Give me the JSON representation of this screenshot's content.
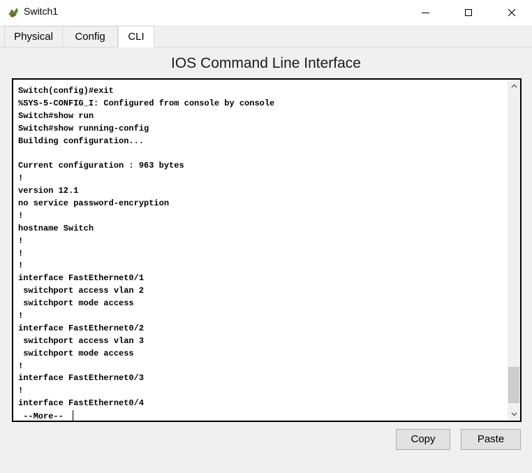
{
  "window": {
    "title": "Switch1",
    "icon": "switch-device-icon",
    "controls": {
      "minimize_icon": "minimize-icon",
      "maximize_icon": "maximize-icon",
      "close_icon": "close-icon",
      "close_glyph": "✕"
    }
  },
  "tabs": [
    {
      "label": "Physical",
      "active": false
    },
    {
      "label": "Config",
      "active": false
    },
    {
      "label": "CLI",
      "active": true
    }
  ],
  "cli": {
    "heading": "IOS Command Line Interface",
    "lines": [
      "Switch(config)#exit",
      "%SYS-5-CONFIG_I: Configured from console by console",
      "Switch#show run",
      "Switch#show running-config",
      "Building configuration...",
      "",
      "Current configuration : 963 bytes",
      "!",
      "version 12.1",
      "no service password-encryption",
      "!",
      "hostname Switch",
      "!",
      "!",
      "!",
      "interface FastEthernet0/1",
      " switchport access vlan 2",
      " switchport mode access",
      "!",
      "interface FastEthernet0/2",
      " switchport access vlan 3",
      " switchport mode access",
      "!",
      "interface FastEthernet0/3",
      "!",
      "interface FastEthernet0/4",
      " --More-- "
    ],
    "scroll_position": 0.95
  },
  "buttons": {
    "copy": "Copy",
    "paste": "Paste"
  },
  "colors": {
    "background": "#f0f0f0",
    "terminal_bg": "#ffffff",
    "terminal_text": "#000000"
  }
}
